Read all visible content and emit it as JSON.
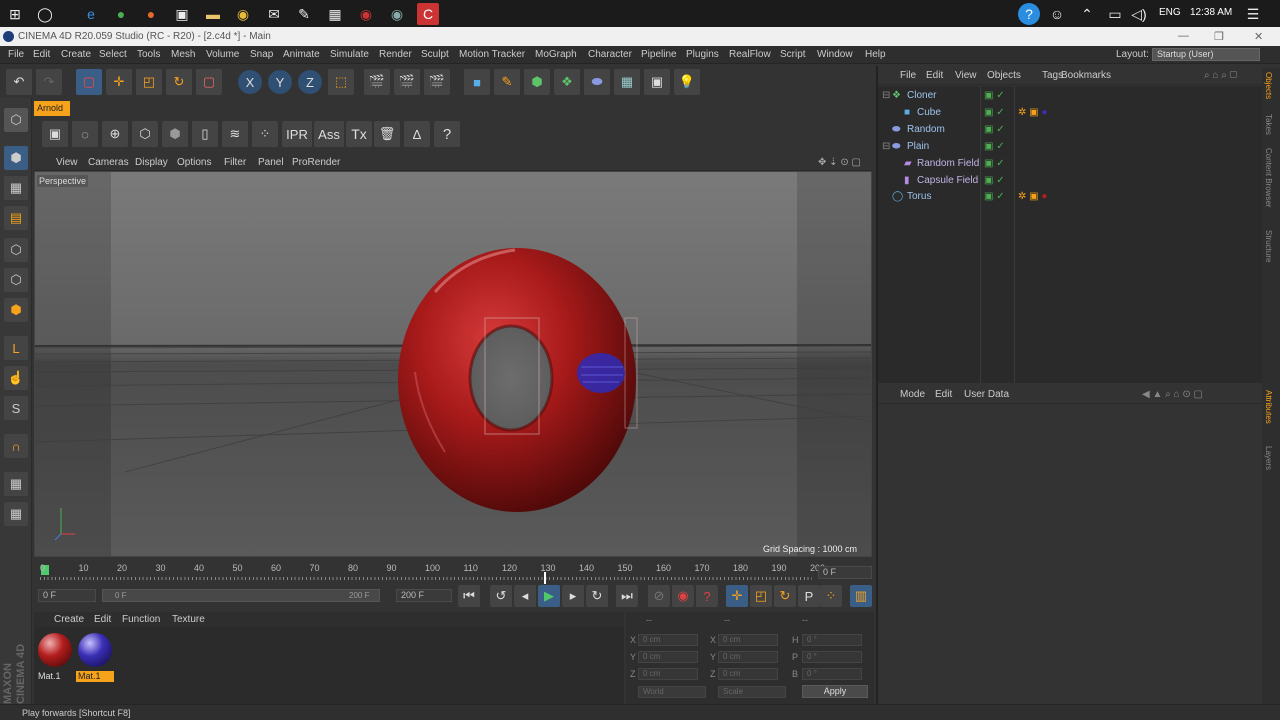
{
  "taskbar": {
    "tray": {
      "language": "ENG",
      "time": "12:38 AM"
    }
  },
  "window": {
    "title": "CINEMA 4D R20.059 Studio (RC - R20) - [2.c4d *] - Main"
  },
  "menubar": {
    "items": [
      "File",
      "Edit",
      "Create",
      "Select",
      "Tools",
      "Mesh",
      "Volume",
      "Snap",
      "Animate",
      "Simulate",
      "Render",
      "Sculpt",
      "Motion Tracker",
      "MoGraph",
      "Character",
      "Pipeline",
      "Plugins",
      "RealFlow",
      "Script",
      "Window",
      "Help"
    ],
    "layout_label": "Layout:",
    "layout_value": "Startup (User)"
  },
  "arnold": {
    "tab_label": "Arnold",
    "tools": {
      "ipr": "IPR",
      "ass": "Ass",
      "tx": "Tx",
      "help": "?"
    }
  },
  "viewport": {
    "menu": [
      "View",
      "Cameras",
      "Display",
      "Options",
      "Filter",
      "Panel",
      "ProRender"
    ],
    "camera_label": "Perspective",
    "grid_spacing": "Grid Spacing : 1000 cm"
  },
  "timeline": {
    "ticks": [
      "0",
      "10",
      "20",
      "30",
      "40",
      "50",
      "60",
      "70",
      "80",
      "90",
      "100",
      "110",
      "120",
      "130",
      "140",
      "150",
      "160",
      "170",
      "180",
      "190",
      "200"
    ],
    "current_frame": "0 F"
  },
  "transport": {
    "start_field": "0 F",
    "range_start": "0 F",
    "range_end": "200 F",
    "end_field": "200 F"
  },
  "material_manager": {
    "menu": [
      "Create",
      "Edit",
      "Function",
      "Texture"
    ],
    "materials": [
      {
        "name": "Mat.1",
        "color": "#b31d1d"
      },
      {
        "name": "Mat.1",
        "color": "#3a2fb5"
      }
    ]
  },
  "coordinates": {
    "col1": [
      "X",
      "Y",
      "Z"
    ],
    "col2": [
      "X",
      "Y",
      "Z"
    ],
    "col3": [
      "H",
      "P",
      "B"
    ],
    "values": {
      "pos": "0 cm",
      "size": "0 cm",
      "rot": "0 °"
    },
    "world": "World",
    "scale": "Scale",
    "apply": "Apply",
    "header_dashes": [
      "--",
      "--",
      "--"
    ]
  },
  "object_manager": {
    "menu": [
      "File",
      "Edit",
      "View",
      "Objects",
      "Tags",
      "Bookmarks"
    ],
    "objects": [
      {
        "name": "Cloner",
        "indent": 0,
        "color": "#9ec4ec"
      },
      {
        "name": "Cube",
        "indent": 1,
        "color": "#9ec4ec"
      },
      {
        "name": "Random",
        "indent": 0,
        "color": "#9ec4ec"
      },
      {
        "name": "Plain",
        "indent": 0,
        "color": "#9ec4ec"
      },
      {
        "name": "Random Field",
        "indent": 1,
        "color": "#c0b3e6"
      },
      {
        "name": "Capsule Field",
        "indent": 1,
        "color": "#c0b3e6"
      },
      {
        "name": "Torus",
        "indent": 0,
        "color": "#9ec4ec"
      }
    ]
  },
  "attribute_manager": {
    "menu": [
      "Mode",
      "Edit",
      "User Data"
    ]
  },
  "right_tabs": [
    "Objects",
    "Takes",
    "Content Browser",
    "Structure",
    "Attributes",
    "Layers"
  ],
  "status": {
    "text": "Play forwards [Shortcut F8]"
  },
  "branding": {
    "maxon": "MAXON",
    "cinema": "CINEMA 4D"
  },
  "colors": {
    "accent": "#f7a21b",
    "torus": "#a81a1a",
    "cube_blue": "#2d2bb8"
  }
}
